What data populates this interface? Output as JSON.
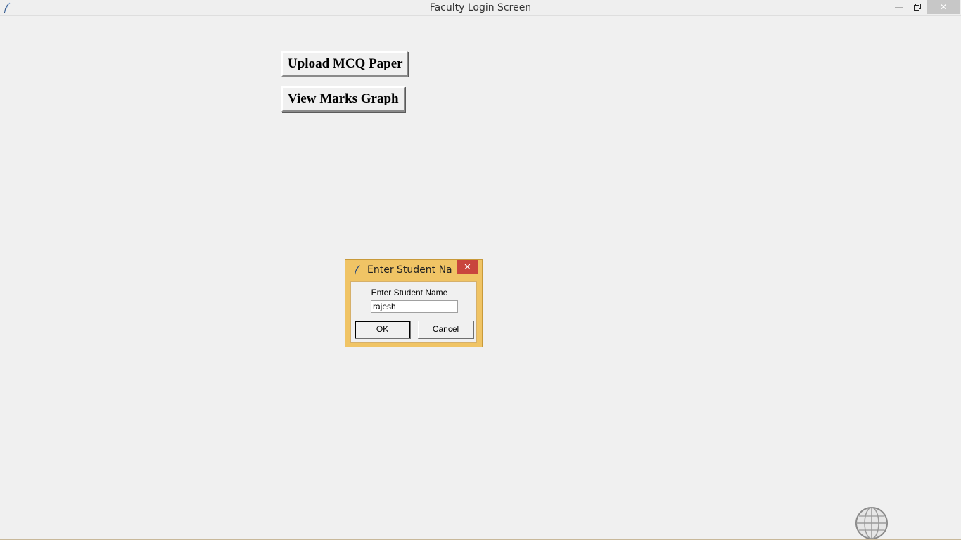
{
  "window": {
    "title": "Faculty Login Screen",
    "icon": "feather-icon",
    "controls": [
      "minimize-icon",
      "restore-icon",
      "close-icon"
    ]
  },
  "main": {
    "upload_label": "Upload MCQ Paper",
    "graph_label": "View Marks Graph"
  },
  "dialog": {
    "title": "Enter Student Na...",
    "label": "Enter Student Name",
    "input_value": "rajesh",
    "ok_label": "OK",
    "cancel_label": "Cancel",
    "accent": "#f0c465",
    "close_color": "#c9453d"
  }
}
